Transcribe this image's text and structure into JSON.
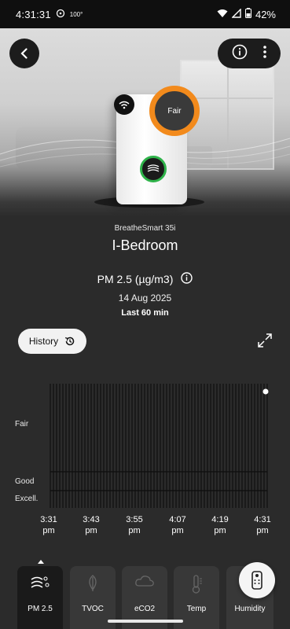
{
  "status_bar": {
    "time": "4:31:31",
    "aux_text": "100°",
    "battery": "42%"
  },
  "hero": {
    "air_quality_badge": "Fair"
  },
  "device": {
    "model": "BreatheSmart 35i",
    "room": "I-Bedroom"
  },
  "metric": {
    "label": "PM 2.5 (µg/m3)",
    "date": "14 Aug 2025",
    "range": "Last 60 min"
  },
  "history_button": {
    "label": "History"
  },
  "chart_data": {
    "type": "bar",
    "y_levels": [
      "Fair",
      "Good",
      "Excell."
    ],
    "x_ticks": [
      "3:31\npm",
      "3:43\npm",
      "3:55\npm",
      "4:07\npm",
      "4:19\npm",
      "4:31\npm"
    ],
    "latest_point_label": "4:31 pm"
  },
  "tabs": [
    {
      "label": "PM 2.5",
      "icon": "pm-icon",
      "active": true
    },
    {
      "label": "TVOC",
      "icon": "leaf-icon",
      "active": false
    },
    {
      "label": "eCO2",
      "icon": "cloud-icon",
      "active": false
    },
    {
      "label": "Temp",
      "icon": "thermometer-icon",
      "active": false
    },
    {
      "label": "Humidity",
      "icon": "droplet-icon",
      "active": false
    }
  ],
  "colors": {
    "accent_orange": "#f28a1c",
    "status_green": "#2fb34a",
    "background": "#2b2b2b"
  }
}
